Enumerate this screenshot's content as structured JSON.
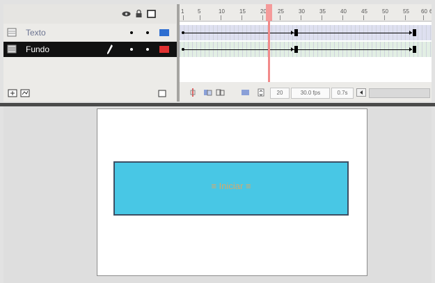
{
  "timeline": {
    "ruler_numbers": [
      "1",
      "5",
      "10",
      "15",
      "20",
      "25",
      "30",
      "35",
      "40",
      "45",
      "50",
      "55",
      "60",
      "6"
    ],
    "layers": [
      {
        "name": "Texto",
        "color": "#2f6fd1"
      },
      {
        "name": "Fundo",
        "color": "#e03030"
      }
    ],
    "footer": {
      "current_frame": "20",
      "frame_rate": "30.0 fps",
      "elapsed_time": "0.7s"
    },
    "playhead_color": "#f28a8a"
  },
  "stage": {
    "button_label": "≡ Iniciar ≡",
    "button_fill": "#48c7e5",
    "button_stroke": "#3c4f64",
    "label_color": "#d7a86a"
  }
}
